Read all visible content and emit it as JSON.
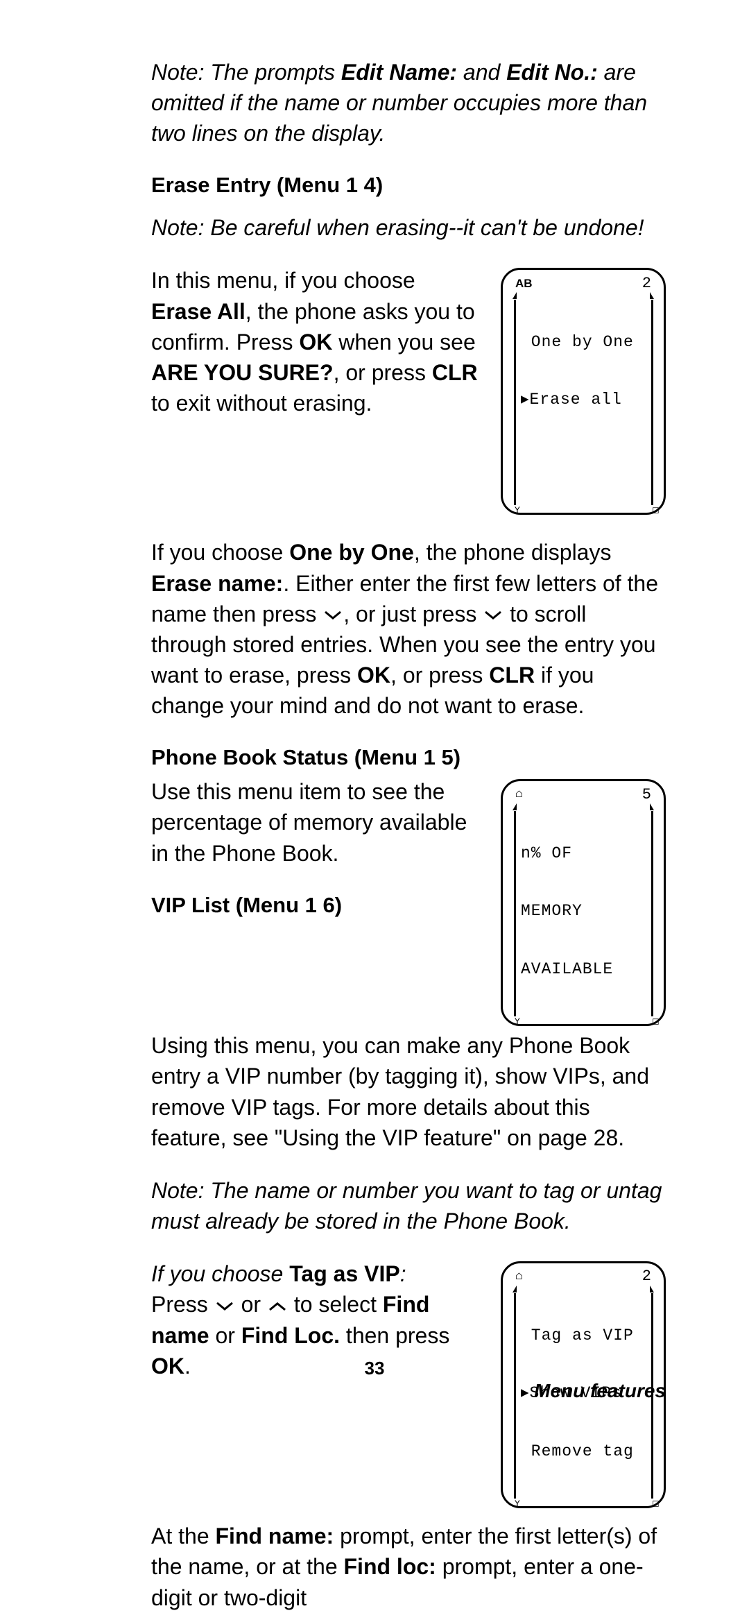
{
  "intro_note": {
    "prefix": "Note: The prompts ",
    "bold1": "Edit Name:",
    "mid1": " and ",
    "bold2": "Edit No.:",
    "suffix": " are omitted if the name or number occupies more than two lines on the display."
  },
  "erase_entry": {
    "heading": "Erase Entry (Menu 1 4)",
    "warn_note": "Note: Be careful when erasing--it can't be undone!",
    "para1": {
      "t1": "In this menu, if you choose ",
      "b1": "Erase All",
      "t2": ", the phone asks you to confirm. Press ",
      "b2": "OK",
      "t3": " when you see ",
      "b3": "ARE YOU SURE?",
      "t4": ", or press ",
      "b4": "CLR",
      "t5": " to exit without erasing."
    },
    "screen": {
      "top_left": "AB",
      "top_right": "2",
      "line1": " One by One",
      "line2": "▸Erase all"
    },
    "para2": {
      "t1": "If you choose ",
      "b1": "One by One",
      "t2": ", the phone displays ",
      "b2": "Erase name:",
      "t3": ". Either enter the first few letters of the name then press ",
      "t4": ", or just press ",
      "t5": " to scroll through stored entries. When you see the entry you want to erase, press ",
      "b3": "OK",
      "t6": ", or press ",
      "b4": "CLR",
      "t7": " if you change your mind and do not want to erase."
    }
  },
  "phone_book_status": {
    "heading": "Phone Book Status (Menu 1 5)",
    "para": "Use this menu item to see the percentage of memory available in the Phone Book.",
    "screen": {
      "top_left_icon": "⌂",
      "top_right": "5",
      "line1": "n% OF",
      "line2": "MEMORY",
      "line3": "AVAILABLE"
    }
  },
  "vip_list": {
    "heading": "VIP List (Menu 1 6)",
    "para1": "Using this menu, you can make any Phone Book entry a VIP number (by tagging it), show VIPs, and remove VIP tags. For more details about this feature, see \"Using the VIP feature\" on page 28.",
    "note": "Note: The name or number you want to tag or untag must already be stored in the Phone Book.",
    "choose": {
      "lead_italic": "If you choose ",
      "lead_bold": "Tag as VIP",
      "lead_colon": ":",
      "t1": "Press ",
      "t2": " or ",
      "t3": " to select ",
      "b1": "Find name",
      "t4": " or ",
      "b2": "Find Loc.",
      "t5": " then press ",
      "b3": "OK",
      "t6": "."
    },
    "screen": {
      "top_left_icon": "⌂",
      "top_right": "2",
      "line1": " Tag as VIP",
      "line2": "▸Show VIPs",
      "line3": " Remove tag"
    },
    "para_after": {
      "t1": "At the ",
      "b1": "Find name:",
      "t2": " prompt, enter the first letter(s) of the name, or at the ",
      "b2": "Find loc:",
      "t3": " prompt, enter a one-digit or two-digit"
    }
  },
  "footer": {
    "page_number": "33",
    "section_label": "Menu features"
  }
}
